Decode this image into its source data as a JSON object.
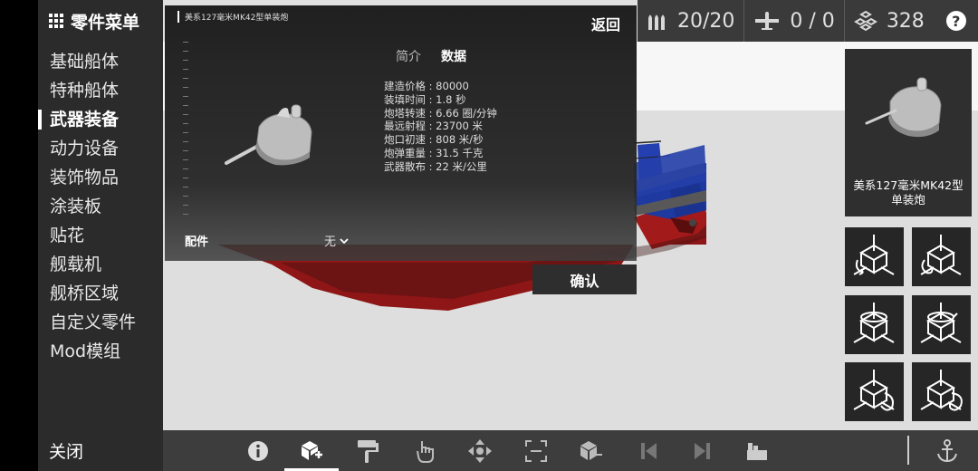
{
  "sidebar": {
    "title": "零件菜单",
    "items": [
      {
        "label": "基础船体",
        "active": false
      },
      {
        "label": "特种船体",
        "active": false
      },
      {
        "label": "武器装备",
        "active": true
      },
      {
        "label": "动力设备",
        "active": false
      },
      {
        "label": "装饰物品",
        "active": false
      },
      {
        "label": "涂装板",
        "active": false
      },
      {
        "label": "贴花",
        "active": false
      },
      {
        "label": "舰载机",
        "active": false
      },
      {
        "label": "舰桥区域",
        "active": false
      },
      {
        "label": "自定义零件",
        "active": false
      },
      {
        "label": "Mod模组",
        "active": false
      }
    ],
    "close_label": "关闭"
  },
  "topbar": {
    "ammo": "20/20",
    "aircraft": "0 / 0",
    "parts": "328",
    "help_label": "?"
  },
  "panel": {
    "part_name": "美系127毫米MK42型单装炮",
    "back_label": "返回",
    "tabs": [
      {
        "label": "简介",
        "active": false
      },
      {
        "label": "数据",
        "active": true
      }
    ],
    "specs": [
      "建造价格 : 80000",
      "装填时间 : 1.8 秒",
      "炮塔转速 : 6.66 圈/分钟",
      "最远射程 : 23700 米",
      "炮口初速 : 808 米/秒",
      "炮弹重量 : 31.5 千克",
      "武器散布 : 22 米/公里"
    ],
    "accessory_label": "配件",
    "accessory_value": "无"
  },
  "confirm_label": "确认",
  "card": {
    "title_line1": "美系127毫米MK42型",
    "title_line2": "单装炮"
  },
  "colors": {
    "hull_red": "#8e1616",
    "hull_blue": "#1e3aa0",
    "deck_gray": "#6a6a6a",
    "panel_bg": "#222222"
  },
  "icons": {
    "toolbar": [
      "info-icon",
      "add-part-icon",
      "paint-roller-icon",
      "hand-pointer-icon",
      "move-arrows-icon",
      "resize-icon",
      "part-rotate-icon",
      "previous-icon",
      "next-icon",
      "factory-icon",
      "anchor-icon"
    ],
    "pads": [
      "rotate-x-ccw-icon",
      "rotate-x-cw-icon",
      "rotate-y-ccw-icon",
      "rotate-y-cw-icon",
      "rotate-z-ccw-icon",
      "rotate-z-cw-icon"
    ]
  }
}
